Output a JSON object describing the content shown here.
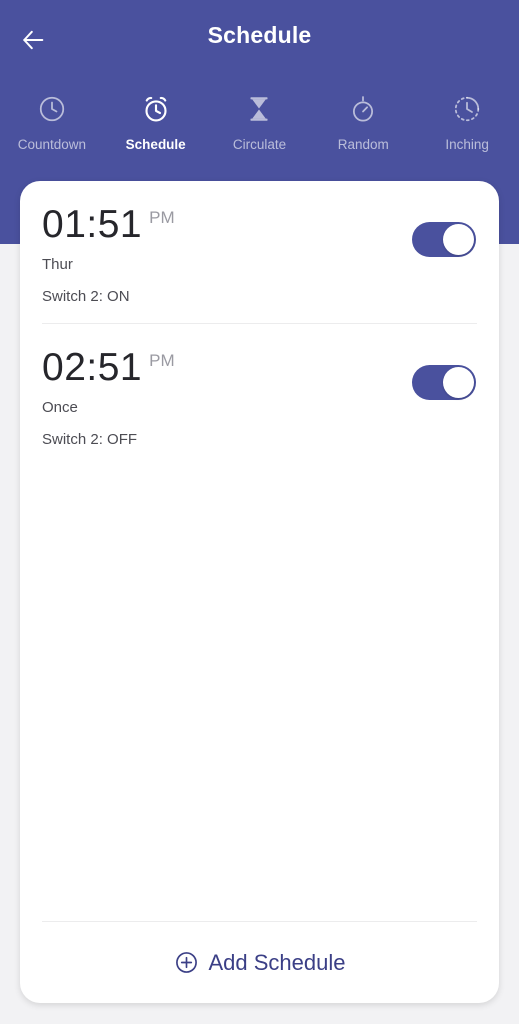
{
  "header": {
    "title": "Schedule",
    "back_icon": "arrow-left-icon",
    "background_color": "#4a519e"
  },
  "tabs": [
    {
      "label": "Countdown",
      "icon": "clock-icon",
      "active": false
    },
    {
      "label": "Schedule",
      "icon": "alarm-clock-icon",
      "active": true
    },
    {
      "label": "Circulate",
      "icon": "hourglass-icon",
      "active": false
    },
    {
      "label": "Random",
      "icon": "stopwatch-icon",
      "active": false
    },
    {
      "label": "Inching",
      "icon": "dashed-clock-icon",
      "active": false
    }
  ],
  "schedules": [
    {
      "time": "01:51",
      "meridiem": "PM",
      "repeat": "Thur",
      "action": "Switch 2: ON",
      "enabled": true
    },
    {
      "time": "02:51",
      "meridiem": "PM",
      "repeat": "Once",
      "action": "Switch 2: OFF",
      "enabled": true
    }
  ],
  "footer": {
    "add_label": "Add Schedule",
    "add_icon": "plus-circle-icon",
    "accent_color": "#3b3f86"
  }
}
